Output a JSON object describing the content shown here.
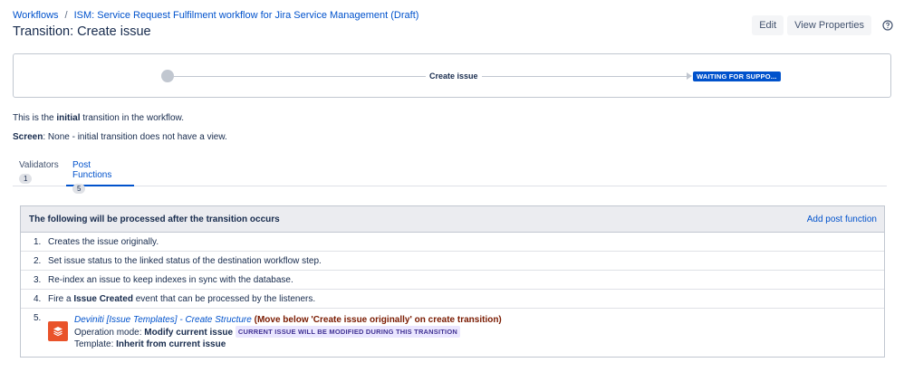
{
  "breadcrumb": {
    "root": "Workflows",
    "separator": "/",
    "current": "ISM: Service Request Fulfilment workflow for Jira Service Management (Draft)"
  },
  "page_title": "Transition: Create issue",
  "actions": {
    "edit": "Edit",
    "view_properties": "View Properties",
    "help_icon": "question-circle-icon"
  },
  "diagram": {
    "transition_label": "Create issue",
    "destination_status": "WAITING FOR SUPPO..."
  },
  "description": {
    "line1_pre": "This is the ",
    "line1_bold": "initial",
    "line1_post": " transition in the workflow.",
    "screen_label": "Screen",
    "screen_value": ": None - initial transition does not have a view."
  },
  "tabs": [
    {
      "label": "Validators",
      "count": "1",
      "active": false
    },
    {
      "label": "Post Functions",
      "count": "5",
      "active": true
    }
  ],
  "post_functions": {
    "header": "The following will be processed after the transition occurs",
    "add_label": "Add post function",
    "items": [
      {
        "num": "1.",
        "text": "Creates the issue originally."
      },
      {
        "num": "2.",
        "text": "Set issue status to the linked status of the destination workflow step."
      },
      {
        "num": "3.",
        "text": "Re-index an issue to keep indexes in sync with the database."
      },
      {
        "num": "4.",
        "pre": "Fire a ",
        "bold": "Issue Created",
        "post": " event that can be processed by the listeners."
      }
    ],
    "item5": {
      "num": "5.",
      "link": "Deviniti [Issue Templates] - Create Structure",
      "note": "(Move below 'Create issue originally' on create transition)",
      "mode_label": "Operation mode: ",
      "mode_value": "Modify current issue",
      "lozenge": "CURRENT ISSUE WILL BE MODIFIED DURING THIS TRANSITION",
      "template_label": "Template: ",
      "template_value": "Inherit from current issue",
      "icon": "issue-templates-layers-icon"
    }
  },
  "colors": {
    "link": "#0052cc",
    "status_blue": "#0052cc",
    "plugin_orange": "#e9532a",
    "note_red": "#7a1a00"
  }
}
